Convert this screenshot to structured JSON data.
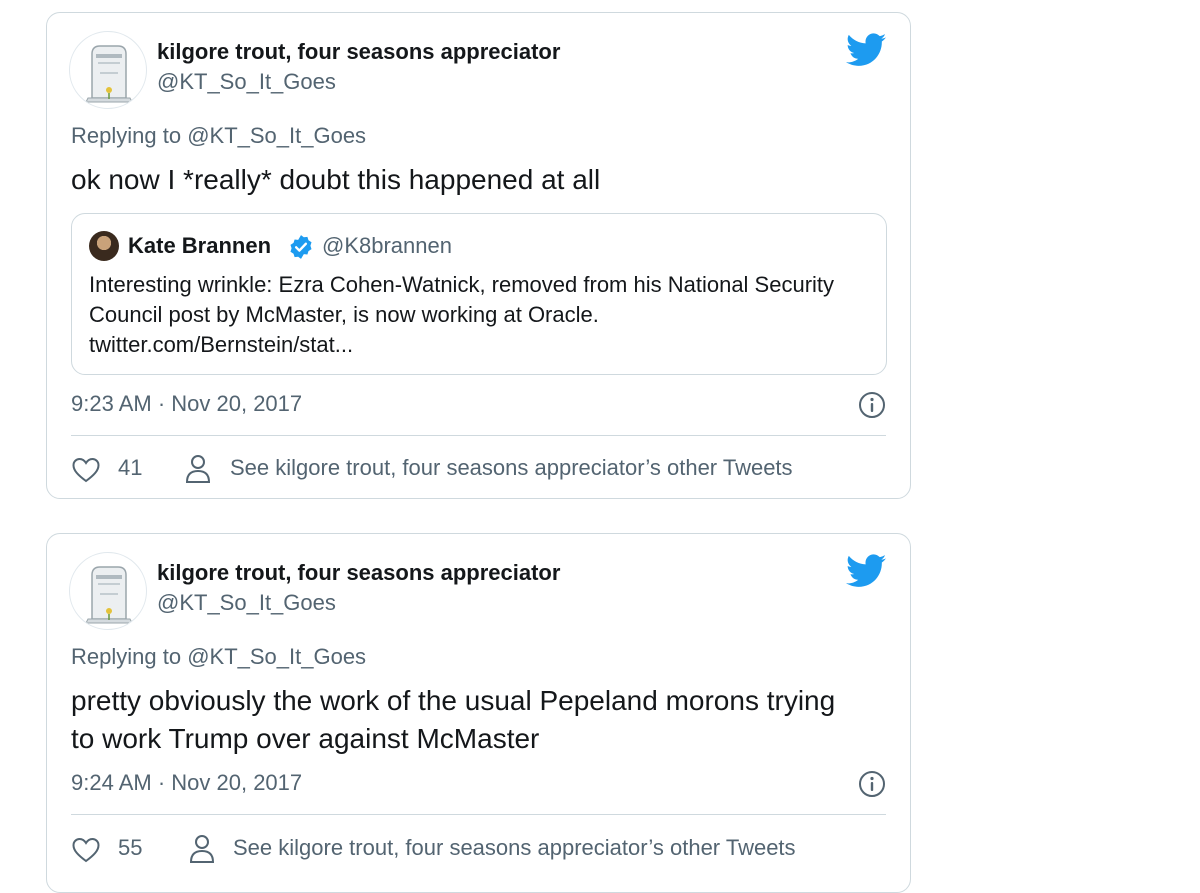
{
  "tweets": [
    {
      "author_name": "kilgore trout, four seasons appreciator",
      "author_handle": "@KT_So_It_Goes",
      "replying_prefix": "Replying to ",
      "replying_to": "@KT_So_It_Goes",
      "text": "ok now I *really* doubt this happened at all",
      "quote": {
        "author_name": "Kate Brannen",
        "author_handle": "@K8brannen",
        "text": "Interesting wrinkle: Ezra Cohen-Watnick, removed from his National Security Council post by McMaster, is now working at Oracle. twitter.com/Bernstein/stat..."
      },
      "timestamp": "9:23 AM · Nov 20, 2017",
      "likes": "41",
      "other_tweets_link": "See kilgore trout, four seasons appreciator’s other Tweets"
    },
    {
      "author_name": "kilgore trout, four seasons appreciator",
      "author_handle": "@KT_So_It_Goes",
      "replying_prefix": "Replying to ",
      "replying_to": "@KT_So_It_Goes",
      "text": "pretty obviously the work of the usual Pepeland morons trying to work Trump over against McMaster",
      "timestamp": "9:24 AM · Nov 20, 2017",
      "likes": "55",
      "other_tweets_link": "See kilgore trout, four seasons appreciator’s other Tweets"
    }
  ],
  "icons": {
    "brand": "twitter-bird-icon",
    "verified": "verified-badge-icon",
    "info": "info-icon",
    "like": "heart-icon",
    "profile": "person-icon"
  },
  "colors": {
    "twitter_blue": "#1d9bf0",
    "secondary_text": "#536471",
    "border": "#cfd9de"
  }
}
